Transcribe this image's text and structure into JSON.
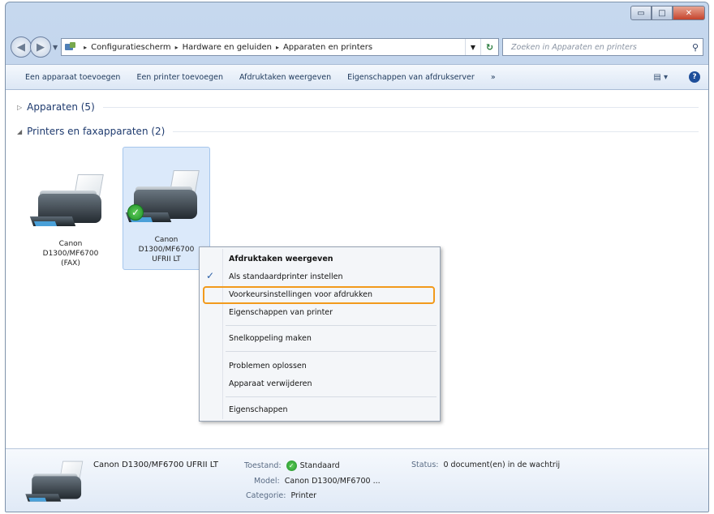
{
  "window": {
    "minimize_glyph": "▭",
    "maximize_glyph": "□",
    "close_glyph": "✕"
  },
  "address_bar": {
    "crumbs": [
      "Configuratiescherm",
      "Hardware en geluiden",
      "Apparaten en printers"
    ],
    "crumb_separator": "▸",
    "search_placeholder": "Zoeken in Apparaten en printers"
  },
  "command_bar": {
    "items": [
      "Een apparaat toevoegen",
      "Een printer toevoegen",
      "Afdruktaken weergeven",
      "Eigenschappen van afdrukserver",
      "»"
    ]
  },
  "groups": [
    {
      "label": "Apparaten (5)",
      "expanded": false
    },
    {
      "label": "Printers en faxapparaten (2)",
      "expanded": true
    }
  ],
  "devices": [
    {
      "line1": "Canon",
      "line2": "D1300/MF6700",
      "line3": "(FAX)",
      "selected": false,
      "is_default": false
    },
    {
      "line1": "Canon",
      "line2": "D1300/MF6700",
      "line3": "UFRII LT",
      "selected": true,
      "is_default": true
    }
  ],
  "context_menu": {
    "items": [
      {
        "label": "Afdruktaken weergeven",
        "bold": true,
        "checked": false
      },
      {
        "label": "Als standaardprinter instellen",
        "bold": false,
        "checked": true
      },
      {
        "label": "Voorkeursinstellingen voor afdrukken",
        "bold": false,
        "checked": false,
        "highlighted": true
      },
      {
        "label": "Eigenschappen van printer",
        "bold": false,
        "checked": false
      },
      {
        "label": "Snelkoppeling maken",
        "bold": false,
        "checked": false
      },
      {
        "label": "Problemen oplossen",
        "bold": false,
        "checked": false
      },
      {
        "label": "Apparaat verwijderen",
        "bold": false,
        "checked": false
      },
      {
        "label": "Eigenschappen",
        "bold": false,
        "checked": false
      }
    ],
    "highlight_color": "#f29a1c"
  },
  "details_pane": {
    "title": "Canon D1300/MF6700 UFRII LT",
    "state_label": "Toestand:",
    "state_value": "Standaard",
    "status_label": "Status:",
    "status_value": "0 document(en) in de wachtrij",
    "model_label": "Model:",
    "model_value": "Canon D1300/MF6700 ...",
    "category_label": "Categorie:",
    "category_value": "Printer"
  }
}
